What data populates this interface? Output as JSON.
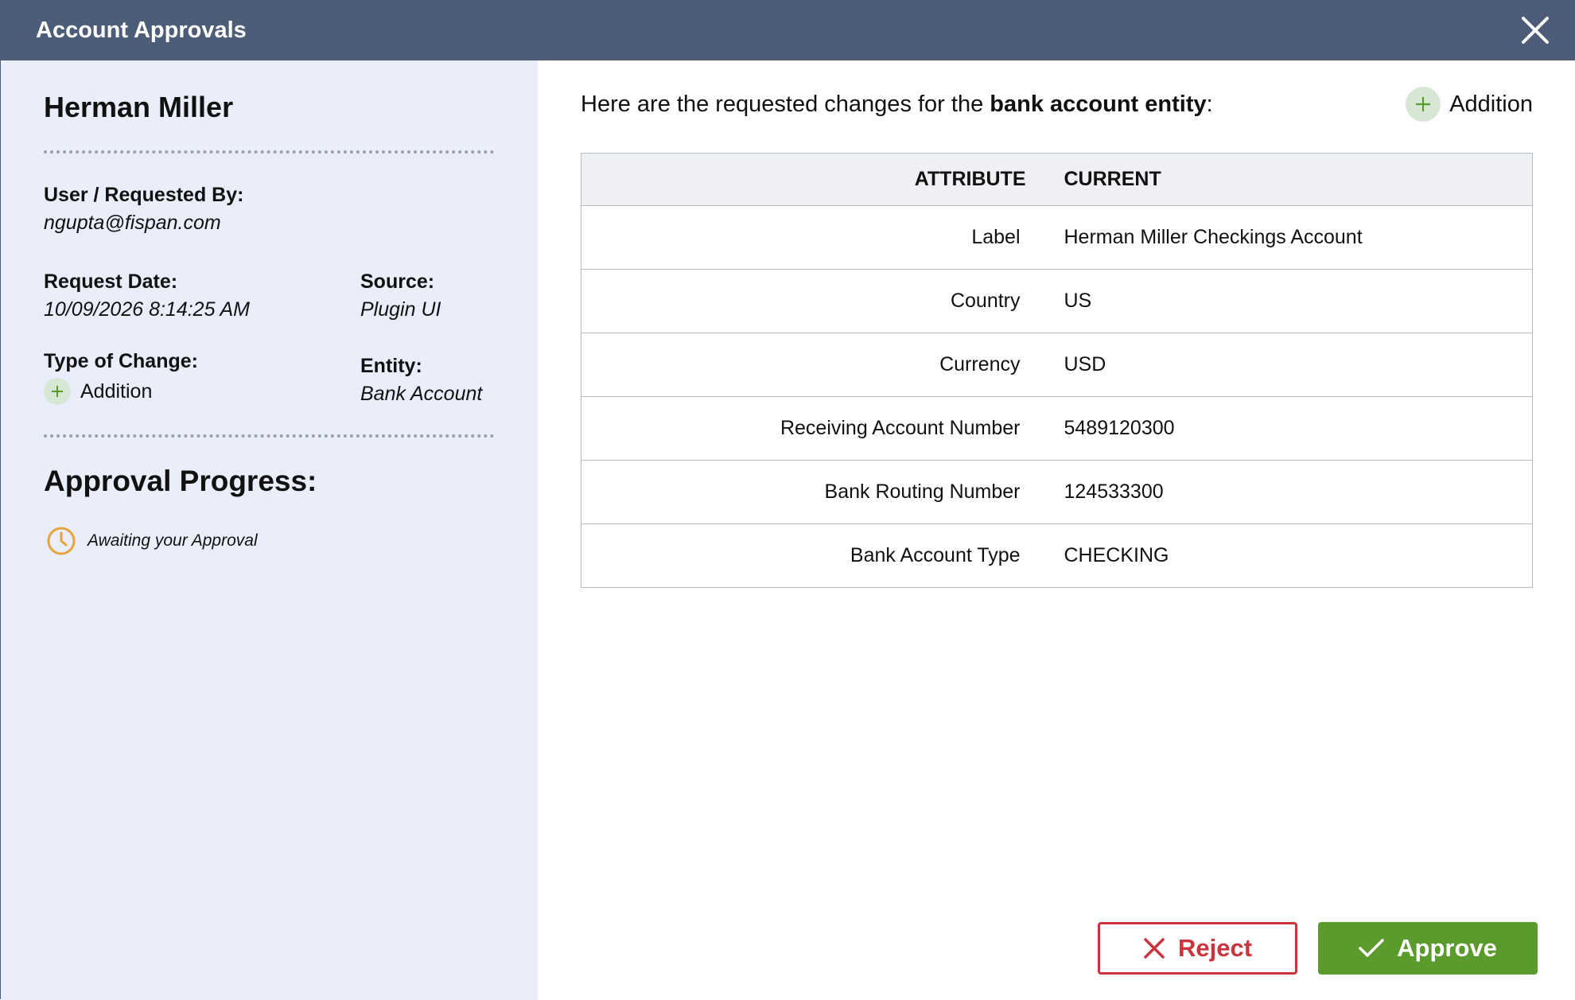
{
  "window": {
    "title": "Account Approvals"
  },
  "sidebar": {
    "name": "Herman Miller",
    "requested_by_label": "User / Requested By:",
    "requested_by_value": "ngupta@fispan.com",
    "request_date_label": "Request Date:",
    "request_date_value": "10/09/2026 8:14:25 AM",
    "source_label": "Source:",
    "source_value": "Plugin UI",
    "type_of_change_label": "Type of Change:",
    "type_of_change_value": "Addition",
    "entity_label": "Entity:",
    "entity_value": "Bank Account",
    "approval_progress_title": "Approval Progress:",
    "approval_status": "Awaiting your Approval"
  },
  "main": {
    "intro_prefix": "Here are the requested changes for the ",
    "intro_entity": "bank account entity",
    "intro_suffix": ":",
    "change_badge": "Addition",
    "table": {
      "headers": [
        "ATTRIBUTE",
        "CURRENT"
      ],
      "rows": [
        {
          "attribute": "Label",
          "current": "Herman Miller Checkings Account"
        },
        {
          "attribute": "Country",
          "current": "US"
        },
        {
          "attribute": "Currency",
          "current": "USD"
        },
        {
          "attribute": "Receiving Account Number",
          "current": "5489120300"
        },
        {
          "attribute": "Bank Routing Number",
          "current": "124533300"
        },
        {
          "attribute": "Bank Account Type",
          "current": "CHECKING"
        }
      ]
    }
  },
  "actions": {
    "reject_label": "Reject",
    "approve_label": "Approve"
  },
  "icons": {
    "close": "close-icon",
    "addition": "plus-icon",
    "pending": "clock-icon",
    "reject": "x-icon",
    "approve": "checkmark-icon"
  },
  "colors": {
    "header": "#4d5d78",
    "sidebar_bg": "#e9eefa",
    "addition_green": "#5b9a2c",
    "pending_orange": "#e8a33d",
    "reject_red": "#c8353c",
    "approve_green": "#5b9a2c"
  }
}
